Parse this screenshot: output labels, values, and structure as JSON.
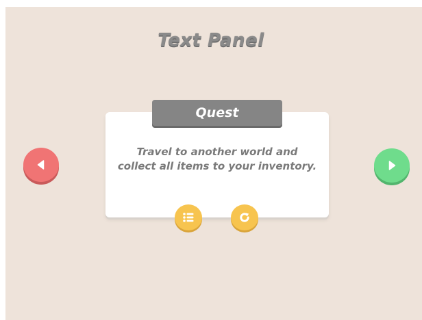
{
  "page": {
    "title": "Text Panel"
  },
  "panel": {
    "header": "Quest",
    "body": "Travel to another world and collect all items to your inventory."
  },
  "buttons": {
    "prev_icon": "triangle-left-icon",
    "next_icon": "triangle-right-icon",
    "list_icon": "list-icon",
    "refresh_icon": "refresh-icon"
  },
  "colors": {
    "background": "#eee3da",
    "panel": "#ffffff",
    "header": "#858585",
    "text": "#7a7a7a",
    "prev_button": "#f07474",
    "next_button": "#6fdc8c",
    "action_button": "#f7c44f"
  }
}
